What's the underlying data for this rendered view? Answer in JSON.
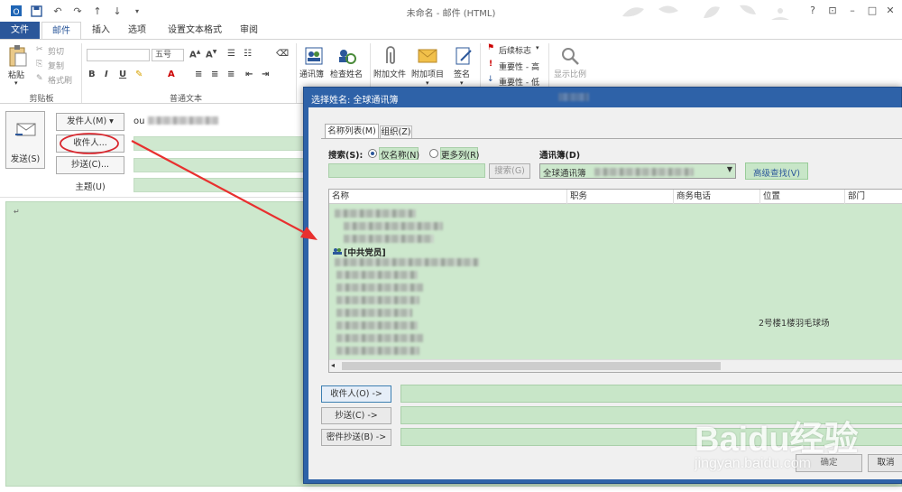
{
  "window": {
    "title": "未命名 - 邮件 (HTML)"
  },
  "tabs": [
    "文件",
    "邮件",
    "插入",
    "选项",
    "设置文本格式",
    "审阅"
  ],
  "clipboard": {
    "paste": "粘贴",
    "cut": "剪切",
    "copy": "复制",
    "format_painter": "格式刷",
    "group": "剪贴板"
  },
  "font": {
    "size": "五号",
    "group": "普通文本"
  },
  "names": {
    "address_book": "通讯簿",
    "check_names": "检查姓名"
  },
  "include": {
    "attach_file": "附加文件",
    "attach_item": "附加项目",
    "signature": "签名"
  },
  "tags": {
    "follow_up": "后续标志",
    "high": "重要性 - 高",
    "low": "重要性 - 低"
  },
  "zoom": {
    "label": "显示比例"
  },
  "compose": {
    "send": "发送(S)",
    "from": "发件人(M)",
    "from_value": "ou",
    "to": "收件人...",
    "cc": "抄送(C)...",
    "subject": "主题(U)"
  },
  "dialog": {
    "title": "选择姓名: 全球通讯簿",
    "tab_names": "名称列表(M)",
    "tab_org": "组织(Z)",
    "search_label": "搜索(S):",
    "radio_name_only": "仅名称(N)",
    "radio_more_cols": "更多列(R)",
    "search_button": "搜索(G)",
    "address_book_label": "通讯簿(D)",
    "address_book_value": "全球通讯簿",
    "advanced": "高级查找(V)",
    "columns": [
      "名称",
      "职务",
      "商务电话",
      "位置",
      "部门"
    ],
    "group_row": "[中共党员]",
    "location_value": "2号楼1楼羽毛球场",
    "to_btn": "收件人(O) ->",
    "cc_btn": "抄送(C) ->",
    "bcc_btn": "密件抄送(B) ->",
    "ok": "确定",
    "cancel": "取消"
  },
  "watermark": {
    "brand": "Baidu经验",
    "url": "jingyan.baidu.com"
  }
}
